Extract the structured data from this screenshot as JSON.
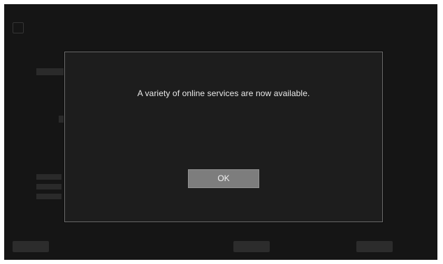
{
  "dialog": {
    "message": "A variety of online services are now available.",
    "ok_label": "OK"
  }
}
